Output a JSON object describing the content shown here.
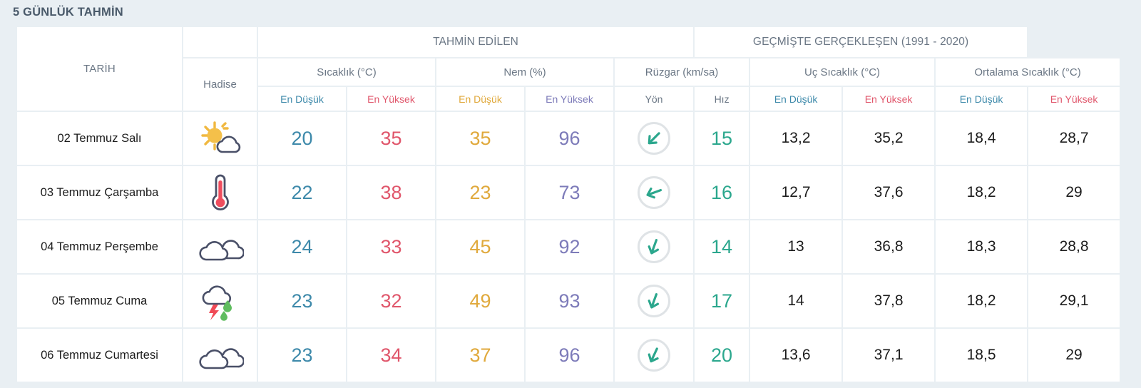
{
  "page": {
    "title": "5 GÜNLÜK TAHMİN",
    "background_color": "#e9eff3"
  },
  "colors": {
    "min_temp": "#3d89aa",
    "max_temp": "#e0566b",
    "min_humidity": "#e0a93c",
    "max_humidity": "#7d7bb9",
    "wind_speed": "#2ba78d",
    "header_text": "#6b7785",
    "title_text": "#4a5a6a",
    "value_text": "#1c1c1c"
  },
  "header": {
    "date_column": "TARİH",
    "event_column": "Hadise",
    "groups": [
      {
        "label": "TAHMİN EDİLEN",
        "span": 5
      },
      {
        "label": "GEÇMİŞTE GERÇEKLEŞEN (1991 - 2020)",
        "span": 4
      }
    ],
    "subgroups": [
      {
        "label": "Sıcaklık (°C)",
        "span": 2
      },
      {
        "label": "Nem (%)",
        "span": 2
      },
      {
        "label": "Rüzgar (km/sa)",
        "span": 2
      },
      {
        "label": "Uç Sıcaklık (°C)",
        "span": 2
      },
      {
        "label": "Ortalama Sıcaklık (°C)",
        "span": 2
      }
    ],
    "columns": [
      {
        "label": "En Düşük",
        "color": "#3d89aa"
      },
      {
        "label": "En Yüksek",
        "color": "#e0566b"
      },
      {
        "label": "En Düşük",
        "color": "#e0a93c"
      },
      {
        "label": "En Yüksek",
        "color": "#7d7bb9"
      },
      {
        "label": "Yön",
        "color": "#6b7785"
      },
      {
        "label": "Hız",
        "color": "#6b7785"
      },
      {
        "label": "En Düşük",
        "color": "#3d89aa"
      },
      {
        "label": "En Yüksek",
        "color": "#e0566b"
      },
      {
        "label": "En Düşük",
        "color": "#3d89aa"
      },
      {
        "label": "En Yüksek",
        "color": "#e0566b"
      }
    ]
  },
  "rows": [
    {
      "date": "02 Temmuz Salı",
      "icon": "sun-behind-cloud-icon",
      "temp_min": "20",
      "temp_max": "35",
      "humidity_min": "35",
      "humidity_max": "96",
      "wind_direction_icon": "arrow-down-left-icon",
      "wind_direction_deg": 225,
      "wind_speed": "15",
      "hist_extreme_min": "13,2",
      "hist_extreme_max": "35,2",
      "hist_avg_min": "18,4",
      "hist_avg_max": "28,7"
    },
    {
      "date": "03 Temmuz Çarşamba",
      "icon": "thermometer-hot-icon",
      "temp_min": "22",
      "temp_max": "38",
      "humidity_min": "23",
      "humidity_max": "73",
      "wind_direction_icon": "arrow-left-down-icon",
      "wind_direction_deg": 250,
      "wind_speed": "16",
      "hist_extreme_min": "12,7",
      "hist_extreme_max": "37,6",
      "hist_avg_min": "18,2",
      "hist_avg_max": "29"
    },
    {
      "date": "04 Temmuz Perşembe",
      "icon": "cloudy-icon",
      "temp_min": "24",
      "temp_max": "33",
      "humidity_min": "45",
      "humidity_max": "92",
      "wind_direction_icon": "arrow-down-icon",
      "wind_direction_deg": 200,
      "wind_speed": "14",
      "hist_extreme_min": "13",
      "hist_extreme_max": "36,8",
      "hist_avg_min": "18,3",
      "hist_avg_max": "28,8"
    },
    {
      "date": "05 Temmuz Cuma",
      "icon": "thunderstorm-rain-icon",
      "temp_min": "23",
      "temp_max": "32",
      "humidity_min": "49",
      "humidity_max": "93",
      "wind_direction_icon": "arrow-down-icon",
      "wind_direction_deg": 200,
      "wind_speed": "17",
      "hist_extreme_min": "14",
      "hist_extreme_max": "37,8",
      "hist_avg_min": "18,2",
      "hist_avg_max": "29,1"
    },
    {
      "date": "06 Temmuz Cumartesi",
      "icon": "cloudy-icon",
      "temp_min": "23",
      "temp_max": "34",
      "humidity_min": "37",
      "humidity_max": "96",
      "wind_direction_icon": "arrow-down-icon",
      "wind_direction_deg": 205,
      "wind_speed": "20",
      "hist_extreme_min": "13,6",
      "hist_extreme_max": "37,1",
      "hist_avg_min": "18,5",
      "hist_avg_max": "29"
    }
  ]
}
